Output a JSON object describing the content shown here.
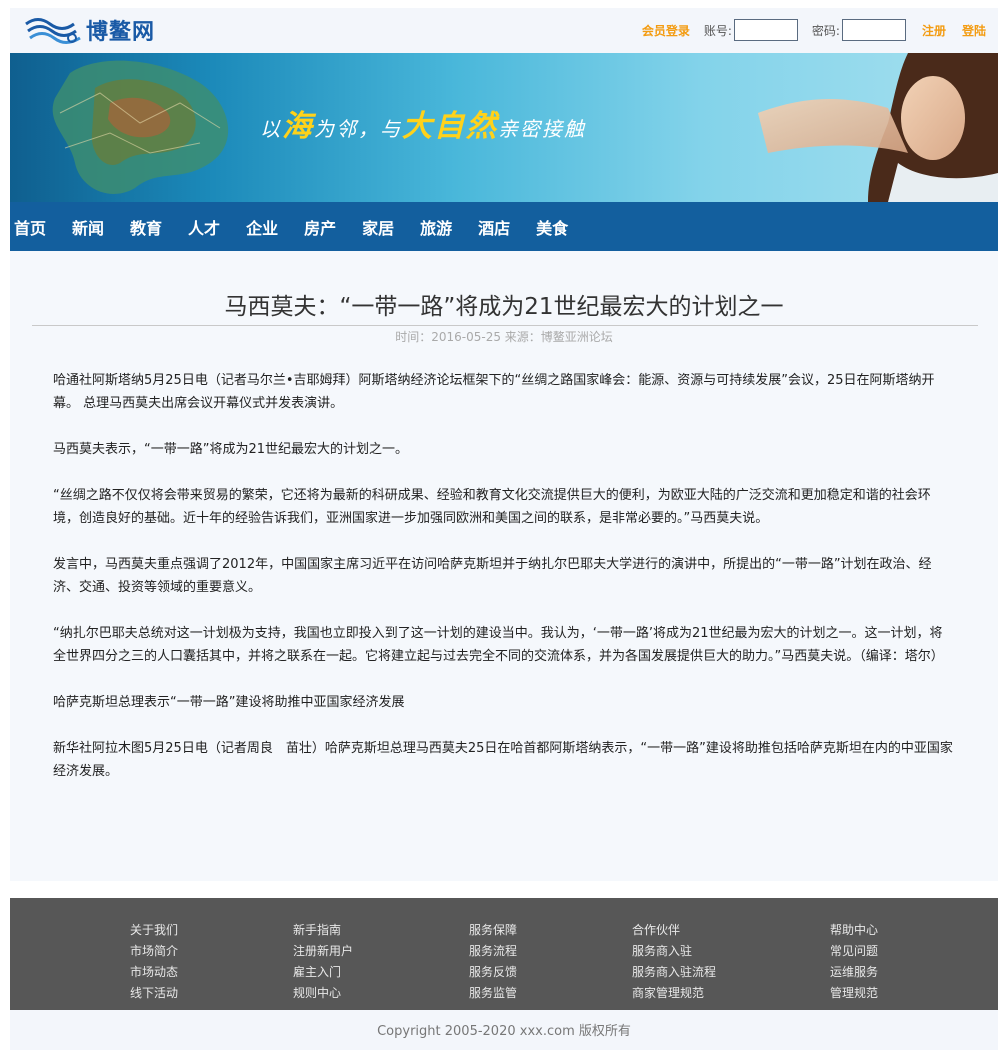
{
  "header": {
    "logo_text": "博鳌网",
    "member_login": "会员登录",
    "account_label": "账号:",
    "password_label": "密码:",
    "account_value": "",
    "password_value": "",
    "register": "注册",
    "login": "登陆"
  },
  "banner": {
    "slogan_a": "以",
    "slogan_b": "海",
    "slogan_c": "为邻，与",
    "slogan_d": "大自然",
    "slogan_e": "亲密接触"
  },
  "nav": {
    "items": [
      "首页",
      "新闻",
      "教育",
      "人才",
      "企业",
      "房产",
      "家居",
      "旅游",
      "酒店",
      "美食"
    ]
  },
  "article": {
    "title": "马西莫夫：“一带一路”将成为21世纪最宏大的计划之一",
    "meta": "时间：2016-05-25 来源：博鳌亚洲论坛",
    "paragraphs": [
      "哈通社阿斯塔纳5月25日电（记者马尔兰•吉耶姆拜）阿斯塔纳经济论坛框架下的“丝绸之路国家峰会：能源、资源与可持续发展”会议，25日在阿斯塔纳开幕。 总理马西莫夫出席会议开幕仪式并发表演讲。",
      "马西莫夫表示，“一带一路”将成为21世纪最宏大的计划之一。",
      "“丝绸之路不仅仅将会带来贸易的繁荣，它还将为最新的科研成果、经验和教育文化交流提供巨大的便利，为欧亚大陆的广泛交流和更加稳定和谐的社会环境，创造良好的基础。近十年的经验告诉我们，亚洲国家进一步加强同欧洲和美国之间的联系，是非常必要的。”马西莫夫说。",
      "发言中，马西莫夫重点强调了2012年，中国国家主席习近平在访问哈萨克斯坦并于纳扎尔巴耶夫大学进行的演讲中，所提出的“一带一路”计划在政治、经济、交通、投资等领域的重要意义。",
      "“纳扎尔巴耶夫总统对这一计划极为支持，我国也立即投入到了这一计划的建设当中。我认为，‘一带一路’将成为21世纪最为宏大的计划之一。这一计划，将全世界四分之三的人口囊括其中，并将之联系在一起。它将建立起与过去完全不同的交流体系，并为各国发展提供巨大的助力。”马西莫夫说。（编译：塔尔）",
      "哈萨克斯坦总理表示“一带一路”建设将助推中亚国家经济发展",
      "新华社阿拉木图5月25日电（记者周良　苗壮）哈萨克斯坦总理马西莫夫25日在哈首都阿斯塔纳表示，“一带一路”建设将助推包括哈萨克斯坦在内的中亚国家经济发展。"
    ]
  },
  "footer": {
    "columns": [
      [
        "关于我们",
        "市场简介",
        "市场动态",
        "线下活动"
      ],
      [
        "新手指南",
        "注册新用户",
        "雇主入门",
        "规则中心"
      ],
      [
        "服务保障",
        "服务流程",
        "服务反馈",
        "服务监管"
      ],
      [
        "合作伙伴",
        "服务商入驻",
        "服务商入驻流程",
        "商家管理规范"
      ],
      [
        "帮助中心",
        "常见问题",
        "运维服务",
        "管理规范"
      ]
    ],
    "copyright": "Copyright 2005-2020 xxx.com 版权所有"
  }
}
